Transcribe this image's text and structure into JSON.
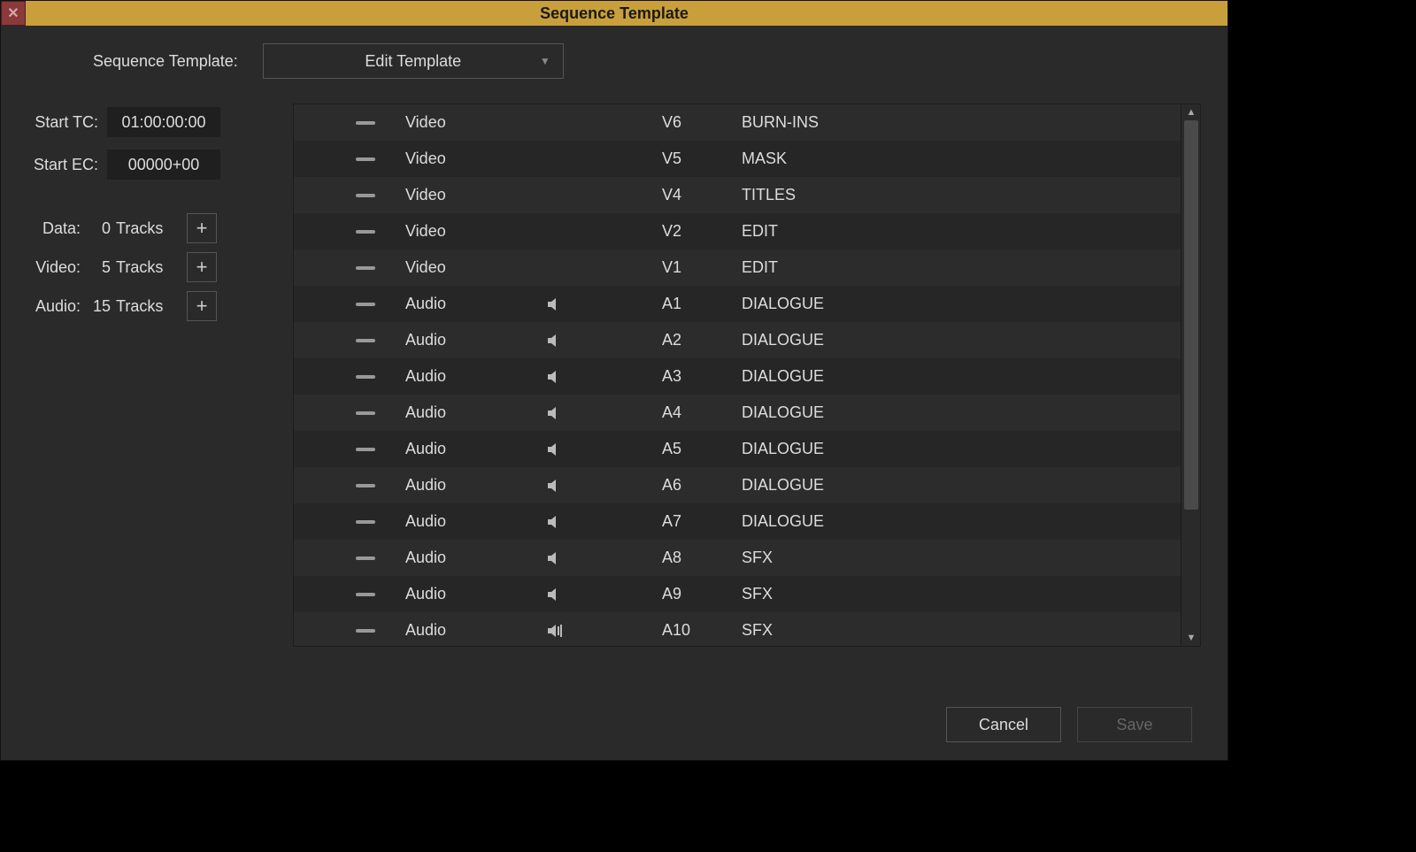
{
  "window": {
    "title": "Sequence Template"
  },
  "top": {
    "label": "Sequence Template:",
    "dropdown_value": "Edit Template"
  },
  "fields": {
    "start_tc_label": "Start TC:",
    "start_tc_value": "01:00:00:00",
    "start_ec_label": "Start EC:",
    "start_ec_value": "00000+00"
  },
  "counts": {
    "data_label": "Data:",
    "data_value": "0",
    "data_unit": "Tracks",
    "video_label": "Video:",
    "video_value": "5",
    "video_unit": "Tracks",
    "audio_label": "Audio:",
    "audio_value": "15",
    "audio_unit": "Tracks"
  },
  "plus_label": "+",
  "tracks": [
    {
      "type": "Video",
      "speaker": "none",
      "id": "V6",
      "name": "BURN-INS"
    },
    {
      "type": "Video",
      "speaker": "none",
      "id": "V5",
      "name": "MASK"
    },
    {
      "type": "Video",
      "speaker": "none",
      "id": "V4",
      "name": "TITLES"
    },
    {
      "type": "Video",
      "speaker": "none",
      "id": "V2",
      "name": "EDIT"
    },
    {
      "type": "Video",
      "speaker": "none",
      "id": "V1",
      "name": "EDIT"
    },
    {
      "type": "Audio",
      "speaker": "mono",
      "id": "A1",
      "name": "DIALOGUE"
    },
    {
      "type": "Audio",
      "speaker": "mono",
      "id": "A2",
      "name": "DIALOGUE"
    },
    {
      "type": "Audio",
      "speaker": "mono",
      "id": "A3",
      "name": "DIALOGUE"
    },
    {
      "type": "Audio",
      "speaker": "mono",
      "id": "A4",
      "name": "DIALOGUE"
    },
    {
      "type": "Audio",
      "speaker": "mono",
      "id": "A5",
      "name": "DIALOGUE"
    },
    {
      "type": "Audio",
      "speaker": "mono",
      "id": "A6",
      "name": "DIALOGUE"
    },
    {
      "type": "Audio",
      "speaker": "mono",
      "id": "A7",
      "name": "DIALOGUE"
    },
    {
      "type": "Audio",
      "speaker": "mono",
      "id": "A8",
      "name": "SFX"
    },
    {
      "type": "Audio",
      "speaker": "mono",
      "id": "A9",
      "name": "SFX"
    },
    {
      "type": "Audio",
      "speaker": "stereo",
      "id": "A10",
      "name": "SFX"
    }
  ],
  "footer": {
    "cancel": "Cancel",
    "save": "Save"
  }
}
